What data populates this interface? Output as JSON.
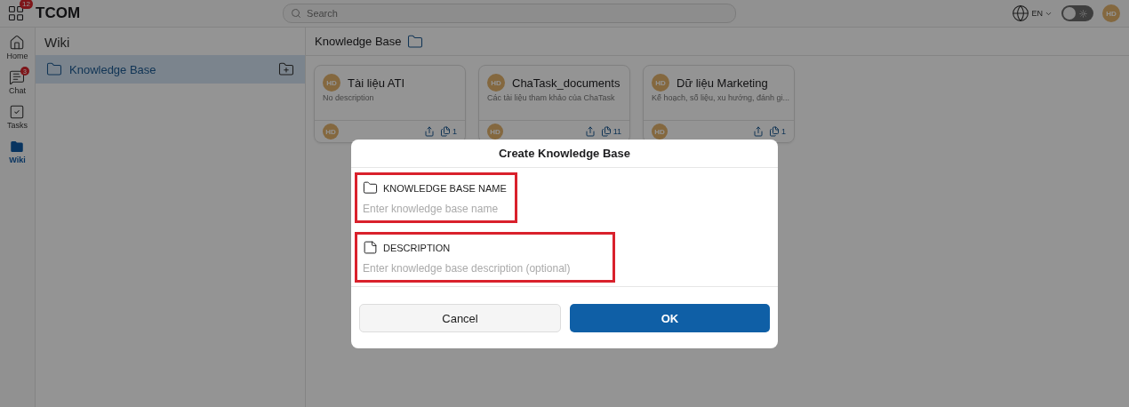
{
  "app": {
    "name": "TCOM",
    "apps_badge": "12"
  },
  "search": {
    "placeholder": "Search"
  },
  "topbar": {
    "language": "EN",
    "dark_mode": false,
    "avatar": "HD"
  },
  "nav": [
    {
      "kind": "home",
      "label": "Home",
      "selected": false
    },
    {
      "kind": "chat",
      "label": "Chat",
      "badge": "3",
      "selected": false
    },
    {
      "kind": "tasks",
      "label": "Tasks",
      "selected": false
    },
    {
      "kind": "wiki",
      "label": "Wiki",
      "selected": true
    }
  ],
  "sidebar": {
    "title": "Wiki",
    "items": [
      {
        "label": "Knowledge Base",
        "selected": true
      }
    ]
  },
  "breadcrumb": "Knowledge Base",
  "cards": [
    {
      "title": "Tài liệu ATI",
      "avatar": "HD",
      "description": "No description",
      "owner": "HD",
      "count": "1"
    },
    {
      "title": "ChaTask_documents",
      "avatar": "HD",
      "description": "Các tài liệu tham khảo của ChaTask",
      "owner": "HD",
      "count": "11"
    },
    {
      "title": "Dữ liệu Marketing",
      "avatar": "HD",
      "description": "Kế hoạch, số liệu, xu hướng, đánh gi...",
      "owner": "HD",
      "count": "1"
    }
  ],
  "dialog": {
    "title": "Create Knowledge Base",
    "fields": [
      {
        "kind": "name",
        "label": "KNOWLEDGE BASE NAME",
        "placeholder": "Enter knowledge base name",
        "highlighted": true
      },
      {
        "kind": "description",
        "label": "DESCRIPTION",
        "placeholder": "Enter knowledge base description (optional)",
        "highlighted": true
      }
    ],
    "buttons": [
      {
        "kind": "secondary",
        "label": "Cancel"
      },
      {
        "kind": "primary",
        "label": "OK"
      }
    ]
  }
}
